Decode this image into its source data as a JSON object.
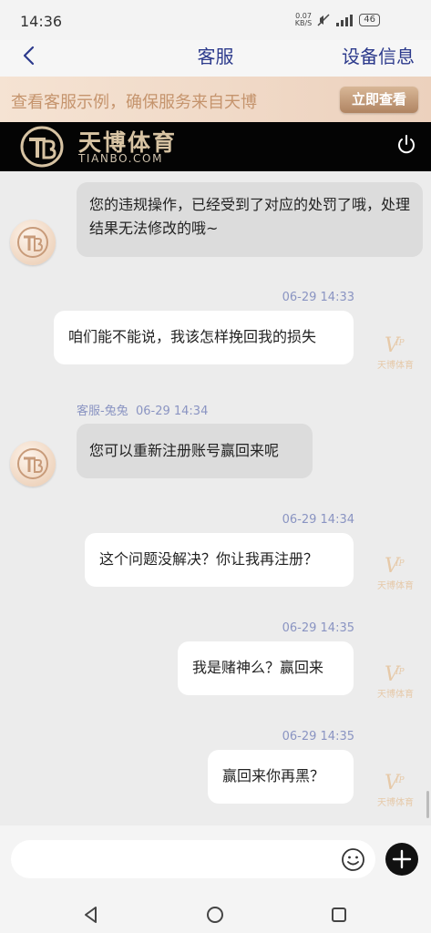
{
  "status_bar": {
    "time": "14:36",
    "speed_value": "0.07",
    "speed_unit": "KB/S",
    "battery": "46"
  },
  "nav": {
    "title": "客服",
    "right_label": "设备信息"
  },
  "promo": {
    "text": "查看客服示例，确保服务来自天博",
    "button_label": "立即查看"
  },
  "brand": {
    "name": "天博体育",
    "domain": "TIANBO.COM"
  },
  "messages": {
    "m1": {
      "text": "您的违规操作，已经受到了对应的处罚了哦，处理结果无法修改的哦~"
    },
    "m2": {
      "time": "06-29 14:33",
      "text": "咱们能不能说，我该怎样挽回我的损失"
    },
    "m3": {
      "sender": "客服-兔兔",
      "time": "06-29 14:34",
      "text": "您可以重新注册账号赢回来呢"
    },
    "m4": {
      "time": "06-29 14:34",
      "text": "这个问题没解决？你让我再注册？"
    },
    "m5": {
      "time": "06-29 14:35",
      "text": "我是赌神么？赢回来"
    },
    "m6": {
      "time": "06-29 14:35",
      "text": "赢回来你再黑？"
    }
  },
  "vip": {
    "badge": "VIP",
    "label": "天博体育"
  },
  "colors": {
    "brand_gold": "#d7c3a3",
    "title_blue": "#2c3a8c",
    "timestamp": "#8a94c2"
  }
}
